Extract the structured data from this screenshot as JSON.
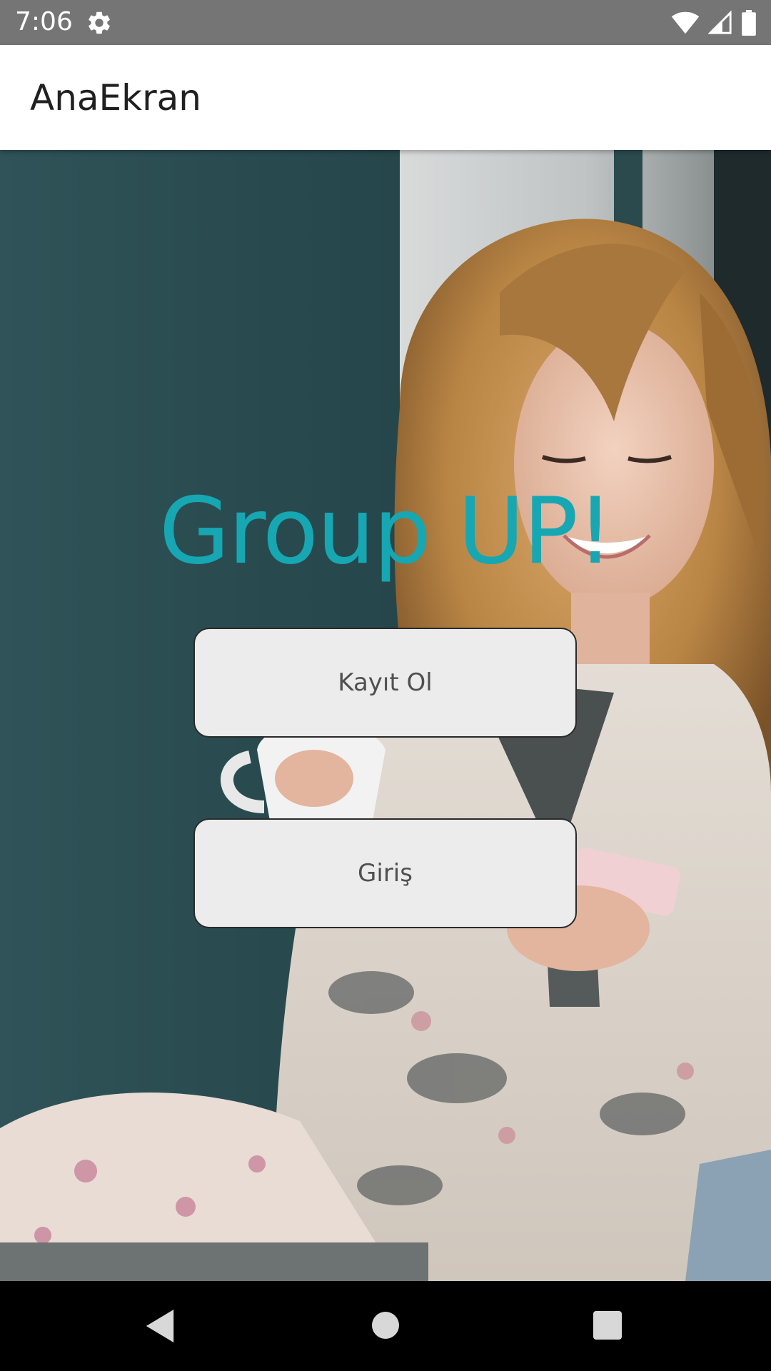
{
  "status_bar": {
    "time": "7:06",
    "icons": [
      "settings-icon",
      "wifi-icon",
      "cell-signal-icon",
      "battery-icon"
    ]
  },
  "app_bar": {
    "title": "AnaEkran"
  },
  "main": {
    "headline": "Group UP!",
    "register_button": "Kayıt Ol",
    "login_button": "Giriş",
    "accent_color": "#16a7b2"
  },
  "nav_bar": {
    "icons": [
      "back-icon",
      "home-icon",
      "recents-icon"
    ]
  }
}
